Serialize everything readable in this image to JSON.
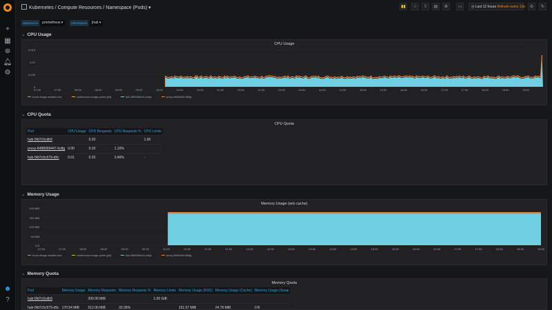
{
  "sidebar": {
    "icons": [
      "grafana-logo",
      "plus-icon",
      "dashboards-icon",
      "explore-icon",
      "alerting-icon",
      "gear-icon",
      "user-icon",
      "help-icon"
    ]
  },
  "topbar": {
    "title": "Kubernetes / Compute Resources / Namespace (Pods)",
    "title_caret": "▾",
    "time_range": "Last 12 hours",
    "refresh": "Refresh every 10s"
  },
  "variables": [
    {
      "label": "datasource",
      "value": "prometheus ▾"
    },
    {
      "label": "namespace",
      "value": "jhub ▾"
    }
  ],
  "rows": {
    "cpu_usage": "CPU Usage",
    "cpu_quota": "CPU Quota",
    "memory_usage": "Memory Usage",
    "memory_quota": "Memory Quota"
  },
  "cpu_panel": {
    "title": "CPU Usage",
    "yticks": [
      "0.015",
      "0.01",
      "0.005",
      "0"
    ],
    "xticks": [
      "07:00",
      "07:30",
      "08:00",
      "08:30",
      "09:00",
      "09:30",
      "10:00",
      "10:30",
      "11:00",
      "11:30",
      "12:00",
      "12:30",
      "13:00",
      "13:30",
      "14:00",
      "14:30",
      "15:00",
      "15:30",
      "16:00",
      "16:30",
      "17:00",
      "17:30",
      "18:00",
      "18:30",
      "19:00"
    ],
    "legend": [
      "hook-image-awaiter-bxx",
      "continuous-image-puller-jp5j",
      "hub-5f6f4d5cc9-zxkjc",
      "proxy-6f46b4fd-f5kfg"
    ]
  },
  "cpu_quota_panel": {
    "title": "CPU Quota",
    "columns": [
      "Pod",
      "CPU Usage",
      "CPU Requests",
      "CPU Requests %",
      "CPU Limits"
    ],
    "rows": [
      [
        "hub-5fd7c5cdb9",
        "",
        "0.20",
        "",
        "1.00"
      ],
      [
        "proxy-8488999447-fcdfg",
        "0.00",
        "0.20",
        "1.10%",
        ""
      ],
      [
        "hub-5fd7c5c579-d9c",
        "0.01",
        "0.20",
        "3.40%",
        "-"
      ]
    ]
  },
  "memory_panel": {
    "title": "Memory Usage (w/o cache)",
    "yticks": [
      "200 MiB",
      "150 MiB",
      "100 MiB",
      "50 MiB",
      "0 B"
    ],
    "xticks": [
      "07:00",
      "07:30",
      "08:00",
      "08:30",
      "09:00",
      "09:30",
      "10:00",
      "10:30",
      "11:00",
      "11:30",
      "12:00",
      "12:30",
      "13:00",
      "13:30",
      "14:00",
      "14:30",
      "15:00",
      "15:30",
      "16:00",
      "16:30",
      "17:00",
      "17:30",
      "18:00",
      "18:30",
      "19:00"
    ],
    "legend": [
      "hook-image-awaiter-bxx",
      "continuous-image-puller-jp5j",
      "hub-5f6f4d5cc9-zxkjc",
      "proxy-6f46b4fd-f5kfg"
    ]
  },
  "memory_quota_panel": {
    "title": "Memory Quota",
    "columns": [
      "Pod",
      "Memory Usage",
      "Memory Requests",
      "Memory Requests %",
      "Memory Limits",
      "Memory Usage (RSS)",
      "Memory Usage (Cache)",
      "Memory Usage (Swap"
    ],
    "rows": [
      [
        "hub-5fd7c5cdb9",
        "",
        "200.00 MiB",
        "",
        "1.00 GiB",
        "",
        "",
        ""
      ],
      [
        "hub-5fd7c5c579-d9c",
        "170.54 MiB",
        "512.00 MiB",
        "33.39%",
        "",
        "151.57 MiB",
        "24.79 MiB",
        "0 B"
      ]
    ]
  },
  "colors": {
    "accent": "#f38b1c",
    "cyan": "#6ed0e0",
    "blue": "#33a2e5"
  }
}
